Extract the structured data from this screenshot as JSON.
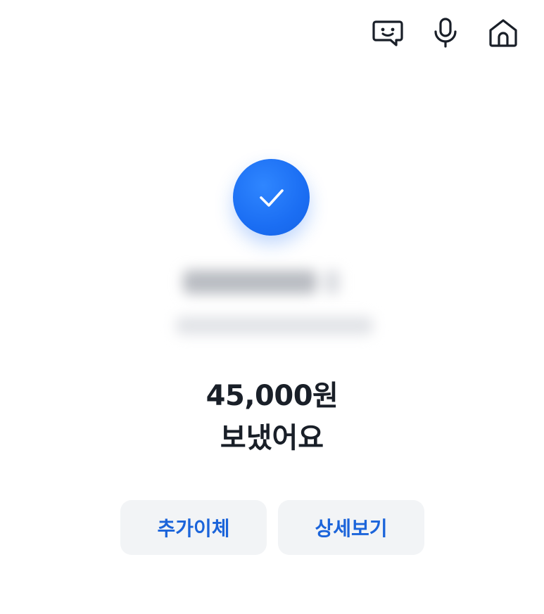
{
  "header": {
    "icons": [
      "chat-smile-icon",
      "microphone-icon",
      "home-icon"
    ]
  },
  "status": {
    "icon": "check-icon",
    "accent_color": "#1b6ef3"
  },
  "recipient": {
    "name_redacted": true,
    "account_redacted": true
  },
  "amount": "45,000원",
  "message": "보냈어요",
  "actions": {
    "add_transfer_label": "추가이체",
    "details_label": "상세보기"
  },
  "colors": {
    "button_bg": "#f2f4f6",
    "button_text": "#1b64da",
    "text_primary": "#191f28"
  }
}
